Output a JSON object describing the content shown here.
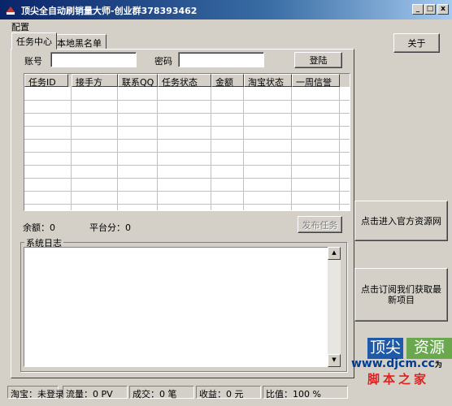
{
  "window": {
    "title": "顶尖全自动刷销量大师-创业群378393462",
    "min_label": "_",
    "max_label": "□",
    "close_label": "x"
  },
  "menu": {
    "config": "配置"
  },
  "tabs": [
    {
      "label": "任务中心"
    },
    {
      "label": "本地黑名单"
    }
  ],
  "login": {
    "account_label": "账号",
    "password_label": "密码",
    "login_button": "登陆"
  },
  "table": {
    "columns": [
      "任务ID",
      "接手方",
      "联系QQ",
      "任务状态",
      "金额",
      "淘宝状态",
      "一周信誉"
    ]
  },
  "balance": {
    "balance_label": "余额：0",
    "platform_points_label": "平台分：0",
    "publish_button": "发布任务"
  },
  "log": {
    "title": "系统日志",
    "content": ""
  },
  "side": {
    "about_button": "关于",
    "official_site_button": "点击进入官方资源网",
    "subscribe_button": "点击订阅我们获取最新项目"
  },
  "status": {
    "taobao": "淘宝：未登录",
    "traffic": "流量：0 PV",
    "deals": "成交：0 笔",
    "income": "收益：0 元",
    "ratio": "比值：100 %"
  },
  "watermark": {
    "left_block": "顶尖",
    "right_block": "资源",
    "url": "www.djcm.cc",
    "url_suffix": "为",
    "site_name": "脚本之家"
  },
  "colors": {
    "title_gradient_start": "#0a246a",
    "title_gradient_end": "#a6caf0",
    "face": "#d4d0c8",
    "watermark_blue": "#1e5aa8",
    "watermark_green": "#6aa84f"
  }
}
